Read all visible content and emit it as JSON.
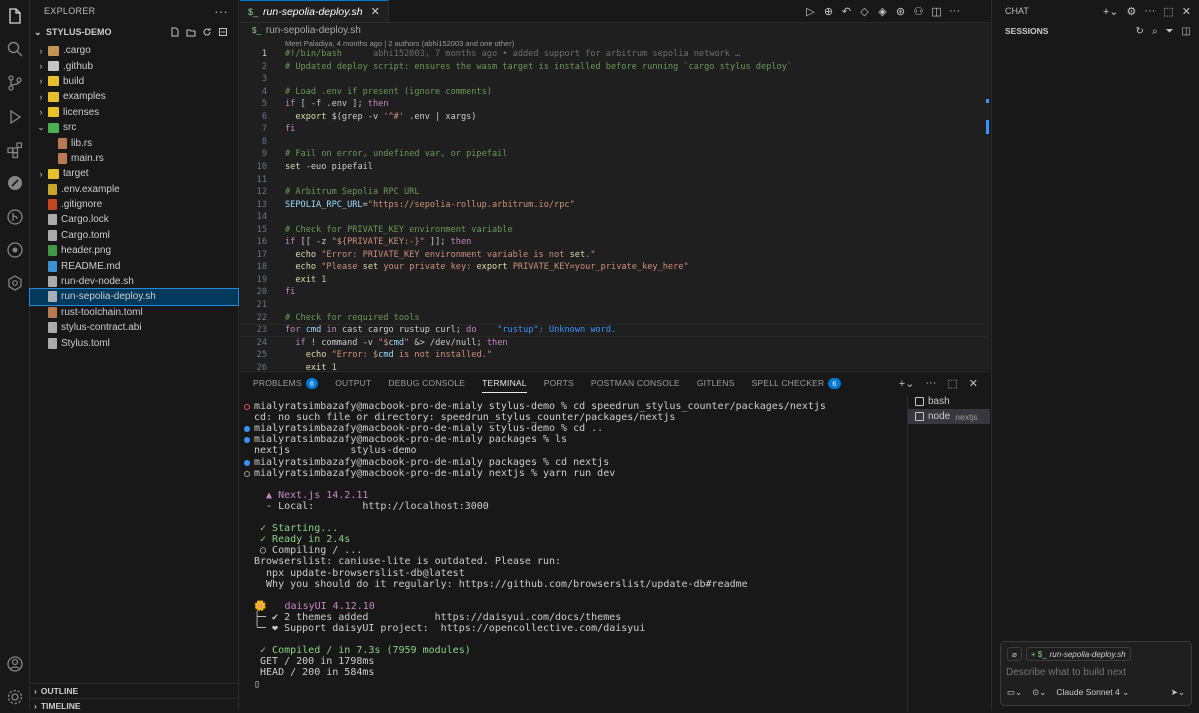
{
  "explorer": {
    "title": "EXPLORER",
    "project": "STYLUS-DEMO",
    "items": [
      {
        "label": ".cargo",
        "kind": "folder",
        "depth": 0,
        "open": false,
        "color": "#c09553"
      },
      {
        "label": ".github",
        "kind": "folder",
        "depth": 0,
        "open": false,
        "color": "#c5c5c5"
      },
      {
        "label": "build",
        "kind": "folder",
        "depth": 0,
        "open": false,
        "color": "#e8c02a"
      },
      {
        "label": "examples",
        "kind": "folder",
        "depth": 0,
        "open": false,
        "color": "#e8c02a"
      },
      {
        "label": "licenses",
        "kind": "folder",
        "depth": 0,
        "open": false,
        "color": "#e8c02a"
      },
      {
        "label": "src",
        "kind": "folder",
        "depth": 0,
        "open": true,
        "color": "#4caf50"
      },
      {
        "label": "lib.rs",
        "kind": "file",
        "depth": 1,
        "color": "#d88b5b"
      },
      {
        "label": "main.rs",
        "kind": "file",
        "depth": 1,
        "color": "#d88b5b"
      },
      {
        "label": "target",
        "kind": "folder",
        "depth": 0,
        "open": false,
        "color": "#e8c02a"
      },
      {
        "label": ".env.example",
        "kind": "file",
        "depth": 0,
        "color": "#e8c02a"
      },
      {
        "label": ".gitignore",
        "kind": "file",
        "depth": 0,
        "color": "#e44d26"
      },
      {
        "label": "Cargo.lock",
        "kind": "file",
        "depth": 0,
        "color": "#c5c5c5"
      },
      {
        "label": "Cargo.toml",
        "kind": "file",
        "depth": 0,
        "color": "#c5c5c5"
      },
      {
        "label": "header.png",
        "kind": "file",
        "depth": 0,
        "color": "#4caf50"
      },
      {
        "label": "README.md",
        "kind": "file",
        "depth": 0,
        "color": "#42a5f5"
      },
      {
        "label": "run-dev-node.sh",
        "kind": "file",
        "depth": 0,
        "color": "#c5c5c5"
      },
      {
        "label": "run-sepolia-deploy.sh",
        "kind": "file",
        "depth": 0,
        "color": "#c5c5c5",
        "selected": true
      },
      {
        "label": "rust-toolchain.toml",
        "kind": "file",
        "depth": 0,
        "color": "#d88b5b"
      },
      {
        "label": "stylus-contract.abi",
        "kind": "file",
        "depth": 0,
        "color": "#c5c5c5"
      },
      {
        "label": "Stylus.toml",
        "kind": "file",
        "depth": 0,
        "color": "#c5c5c5"
      }
    ],
    "outline": "OUTLINE",
    "timeline": "TIMELINE"
  },
  "editor": {
    "tab": "run-sepolia-deploy.sh",
    "breadcrumb": "run-sepolia-deploy.sh",
    "blame_header": "Meet Paladiya, 4 months ago | 2 authors (abhi152003 and one other)",
    "current_line": 23,
    "lines": [
      {
        "n": 1,
        "t": "#!/bin/bash",
        "ghost": "      abhi152003, 7 months ago • added support for arbitrum sepolia network …"
      },
      {
        "n": 2,
        "t": "# Updated deploy script: ensures the wasm target is installed before running `cargo stylus deploy`"
      },
      {
        "n": 3,
        "t": ""
      },
      {
        "n": 4,
        "t": "# Load .env if present (ignore comments)"
      },
      {
        "n": 5,
        "t": "if [ -f .env ]; then"
      },
      {
        "n": 6,
        "t": "  export $(grep -v '^#' .env | xargs)"
      },
      {
        "n": 7,
        "t": "fi"
      },
      {
        "n": 8,
        "t": ""
      },
      {
        "n": 9,
        "t": "# Fail on error, undefined var, or pipefail"
      },
      {
        "n": 10,
        "t": "set -euo pipefail"
      },
      {
        "n": 11,
        "t": ""
      },
      {
        "n": 12,
        "t": "# Arbitrum Sepolia RPC URL"
      },
      {
        "n": 13,
        "t": "SEPOLIA_RPC_URL=\"https://sepolia-rollup.arbitrum.io/rpc\""
      },
      {
        "n": 14,
        "t": ""
      },
      {
        "n": 15,
        "t": "# Check for PRIVATE_KEY environment variable"
      },
      {
        "n": 16,
        "t": "if [[ -z \"${PRIVATE_KEY:-}\" ]]; then"
      },
      {
        "n": 17,
        "t": "  echo \"Error: PRIVATE_KEY environment variable is not set.\""
      },
      {
        "n": 18,
        "t": "  echo \"Please set your private key: export PRIVATE_KEY=your_private_key_here\""
      },
      {
        "n": 19,
        "t": "  exit 1"
      },
      {
        "n": 20,
        "t": "fi"
      },
      {
        "n": 21,
        "t": ""
      },
      {
        "n": 22,
        "t": "# Check for required tools"
      },
      {
        "n": 23,
        "t": "for cmd in cast cargo rustup curl; do",
        "ghost": "    \"rustup\": Unknown word."
      },
      {
        "n": 24,
        "t": "  if ! command -v \"$cmd\" &> /dev/null; then"
      },
      {
        "n": 25,
        "t": "    echo \"Error: $cmd is not installed.\""
      },
      {
        "n": 26,
        "t": "    exit 1"
      }
    ]
  },
  "panel": {
    "tabs": [
      {
        "label": "PROBLEMS",
        "badge": "6"
      },
      {
        "label": "OUTPUT"
      },
      {
        "label": "DEBUG CONSOLE"
      },
      {
        "label": "TERMINAL",
        "active": true
      },
      {
        "label": "PORTS"
      },
      {
        "label": "POSTMAN CONSOLE"
      },
      {
        "label": "GITLENS"
      },
      {
        "label": "SPELL CHECKER",
        "badge": "6"
      }
    ],
    "terminal_lines": [
      {
        "t": "mialyratsimbazafy@macbook-pro-de-mialy stylus-demo % cd speedrun_stylus_counter/packages/nextjs",
        "mark": "error"
      },
      {
        "t": "cd: no such file or directory: speedrun_stylus_counter/packages/nextjs"
      },
      {
        "t": "mialyratsimbazafy@macbook-pro-de-mialy stylus-demo % cd ..",
        "mark": "ok"
      },
      {
        "t": "mialyratsimbazafy@macbook-pro-de-mialy packages % ls",
        "mark": "ok"
      },
      {
        "t": "nextjs          stylus-demo"
      },
      {
        "t": "mialyratsimbazafy@macbook-pro-de-mialy packages % cd nextjs",
        "mark": "ok"
      },
      {
        "t": "mialyratsimbazafy@macbook-pro-de-mialy nextjs % yarn run dev",
        "mark": "run"
      },
      {
        "t": ""
      },
      {
        "t": "  ▲ Next.js 14.2.11",
        "style": "next"
      },
      {
        "t": "  - Local:        http://localhost:3000"
      },
      {
        "t": ""
      },
      {
        "t": " ✓ Starting...",
        "style": "check"
      },
      {
        "t": " ✓ Ready in 2.4s",
        "style": "check"
      },
      {
        "t": " ○ Compiling / ..."
      },
      {
        "t": "Browserslist: caniuse-lite is outdated. Please run:"
      },
      {
        "t": "  npx update-browserslist-db@latest"
      },
      {
        "t": "  Why you should do it regularly: https://github.com/browserslist/update-db#readme"
      },
      {
        "t": ""
      },
      {
        "t": "🌼   daisyUI 4.12.10",
        "style": "daisy"
      },
      {
        "t": "├─ ✔︎ 2 themes added           https://daisyui.com/docs/themes",
        "style": "daisy2"
      },
      {
        "t": "╰─ ❤︎ Support daisyUI project:  https://opencollective.com/daisyui",
        "style": "daisy3"
      },
      {
        "t": ""
      },
      {
        "t": " ✓ Compiled / in 7.3s (7959 modules)",
        "style": "check"
      },
      {
        "t": " GET / 200 in 1798ms",
        "style": "http"
      },
      {
        "t": " HEAD / 200 in 584ms",
        "style": "http"
      },
      {
        "t": "▯"
      }
    ],
    "terminals": [
      {
        "label": "bash"
      },
      {
        "label": "node",
        "sub": "nextjs",
        "selected": true
      }
    ]
  },
  "chat": {
    "title": "CHAT",
    "sessions": "SESSIONS",
    "context_file": "run-sepolia-deploy.sh",
    "placeholder": "Describe what to build next",
    "model": "Claude Sonnet 4"
  }
}
